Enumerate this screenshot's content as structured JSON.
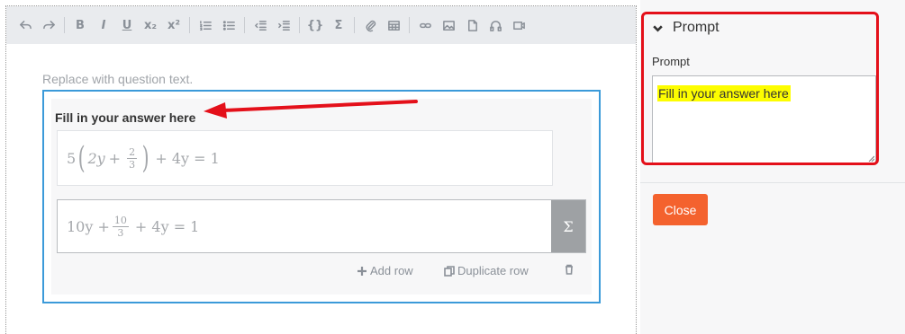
{
  "toolbar": {
    "bold": "B",
    "italic": "I",
    "underline": "U",
    "subscript": "x₂",
    "superscript": "x²",
    "code": "{}",
    "sum": "Σ"
  },
  "editor": {
    "placeholder": "Replace with question text."
  },
  "question": {
    "title": "Fill in your answer here",
    "row1": {
      "coef": "5",
      "var_a": "2y",
      "op1": "+",
      "frac_num": "2",
      "frac_den": "3",
      "tail": "+ 4y = 1"
    },
    "row2": {
      "lead": "10y +",
      "frac_num": "10",
      "frac_den": "3",
      "tail": "+ 4y = 1"
    },
    "sigma_label": "Σ",
    "add_row": "Add row",
    "duplicate_row": "Duplicate row"
  },
  "panel": {
    "section_title": "Prompt",
    "field_label": "Prompt",
    "field_value": "Fill in your answer here",
    "close_label": "Close"
  },
  "colors": {
    "accent_blue": "#3b9ad9",
    "annotation_red": "#e4101a",
    "close_orange": "#f4622e",
    "highlight_yellow": "#fdfd00"
  }
}
